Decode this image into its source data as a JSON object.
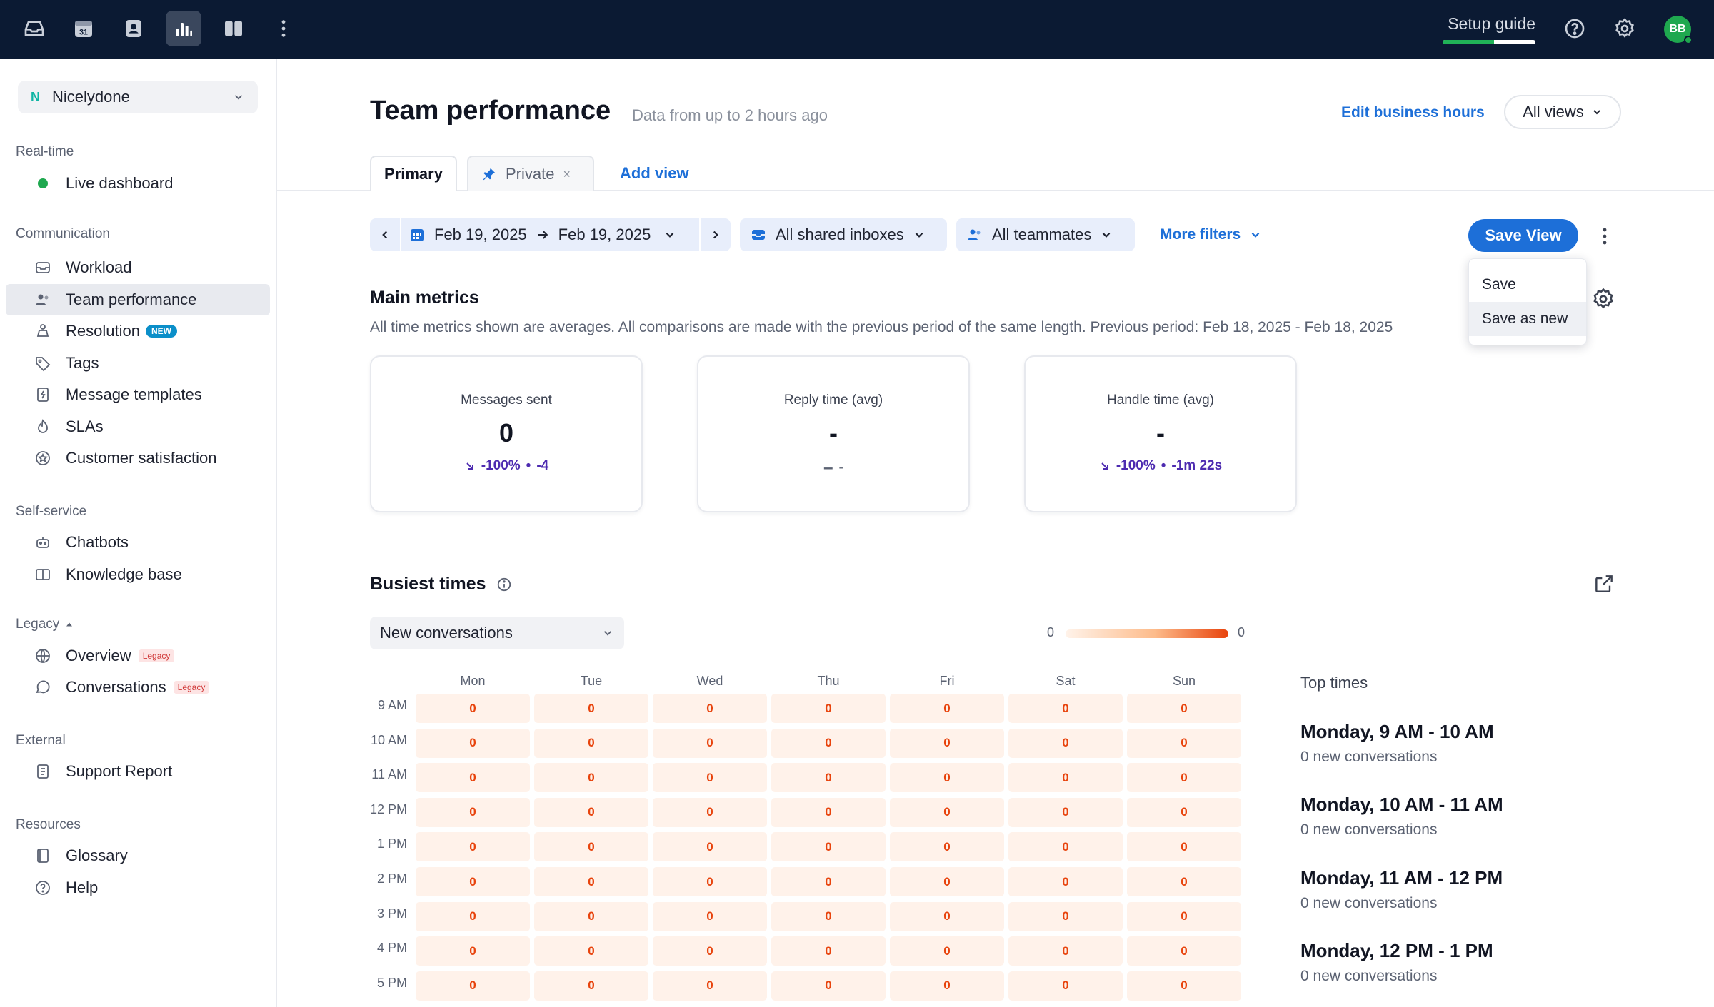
{
  "topbar": {
    "icons": [
      "inbox-icon",
      "calendar-icon",
      "contacts-icon",
      "analytics-icon",
      "knowledge-base-icon",
      "more-vertical-icon"
    ],
    "calendar_day": "31",
    "setup_guide": "Setup guide",
    "setup_progress_percent": 55,
    "avatar_initials": "BB"
  },
  "sidebar": {
    "org": {
      "badge": "N",
      "name": "Nicelydone"
    },
    "sections": {
      "realtime": "Real-time",
      "communication": "Communication",
      "self_service": "Self-service",
      "legacy": "Legacy",
      "external": "External",
      "resources": "Resources"
    },
    "items": {
      "live_dashboard": "Live dashboard",
      "workload": "Workload",
      "team_performance": "Team performance",
      "resolution": "Resolution",
      "resolution_badge": "NEW",
      "tags": "Tags",
      "message_templates": "Message templates",
      "slas": "SLAs",
      "customer_satisfaction": "Customer satisfaction",
      "chatbots": "Chatbots",
      "knowledge_base": "Knowledge base",
      "overview": "Overview",
      "conversations": "Conversations",
      "legacy_badge": "Legacy",
      "support_report": "Support Report",
      "glossary": "Glossary",
      "help": "Help"
    }
  },
  "header": {
    "title": "Team performance",
    "subtitle": "Data from up to 2 hours ago",
    "edit_hours": "Edit business hours",
    "all_views": "All views"
  },
  "tabs": {
    "primary": "Primary",
    "private": "Private",
    "private_close": "×",
    "add_view": "Add view"
  },
  "filters": {
    "date_start": "Feb 19, 2025",
    "date_end": "Feb 19, 2025",
    "inboxes": "All shared inboxes",
    "teammates": "All teammates",
    "more_filters": "More filters",
    "save_view": "Save View"
  },
  "save_menu": {
    "save": "Save",
    "save_as_new": "Save as new"
  },
  "metrics": {
    "title": "Main metrics",
    "description": "All time metrics shown are averages. All comparisons are made with the previous period of the same length. Previous period: Feb 18, 2025 - Feb 18, 2025",
    "cards": [
      {
        "label": "Messages sent",
        "value": "0",
        "change": "-100%",
        "sep": "•",
        "delta": "-4"
      },
      {
        "label": "Reply time (avg)",
        "value": "-",
        "change": "–",
        "delta": "-"
      },
      {
        "label": "Handle time (avg)",
        "value": "-",
        "change": "-100%",
        "sep": "•",
        "delta": "-1m 22s"
      }
    ]
  },
  "busiest": {
    "title": "Busiest times",
    "metric_select": "New conversations",
    "legend_min": "0",
    "legend_max": "0",
    "days": [
      "Mon",
      "Tue",
      "Wed",
      "Thu",
      "Fri",
      "Sat",
      "Sun"
    ],
    "hours": [
      "9 AM",
      "10 AM",
      "11 AM",
      "12 PM",
      "1 PM",
      "2 PM",
      "3 PM",
      "4 PM",
      "5 PM"
    ],
    "cells": [
      [
        "0",
        "0",
        "0",
        "0",
        "0",
        "0",
        "0"
      ],
      [
        "0",
        "0",
        "0",
        "0",
        "0",
        "0",
        "0"
      ],
      [
        "0",
        "0",
        "0",
        "0",
        "0",
        "0",
        "0"
      ],
      [
        "0",
        "0",
        "0",
        "0",
        "0",
        "0",
        "0"
      ],
      [
        "0",
        "0",
        "0",
        "0",
        "0",
        "0",
        "0"
      ],
      [
        "0",
        "0",
        "0",
        "0",
        "0",
        "0",
        "0"
      ],
      [
        "0",
        "0",
        "0",
        "0",
        "0",
        "0",
        "0"
      ],
      [
        "0",
        "0",
        "0",
        "0",
        "0",
        "0",
        "0"
      ],
      [
        "0",
        "0",
        "0",
        "0",
        "0",
        "0",
        "0"
      ]
    ],
    "top_times_title": "Top times",
    "top_times": [
      {
        "range": "Monday, 9 AM - 10 AM",
        "count": "0 new conversations"
      },
      {
        "range": "Monday, 10 AM - 11 AM",
        "count": "0 new conversations"
      },
      {
        "range": "Monday, 11 AM - 12 PM",
        "count": "0 new conversations"
      },
      {
        "range": "Monday, 12 PM - 1 PM",
        "count": "0 new conversations"
      }
    ]
  },
  "colors": {
    "topbar": "#0b1a33",
    "accent": "#1d6fd8",
    "heat_cell": "#fff2ea",
    "heat_text": "#e8430c",
    "avatar": "#1fa84f"
  }
}
